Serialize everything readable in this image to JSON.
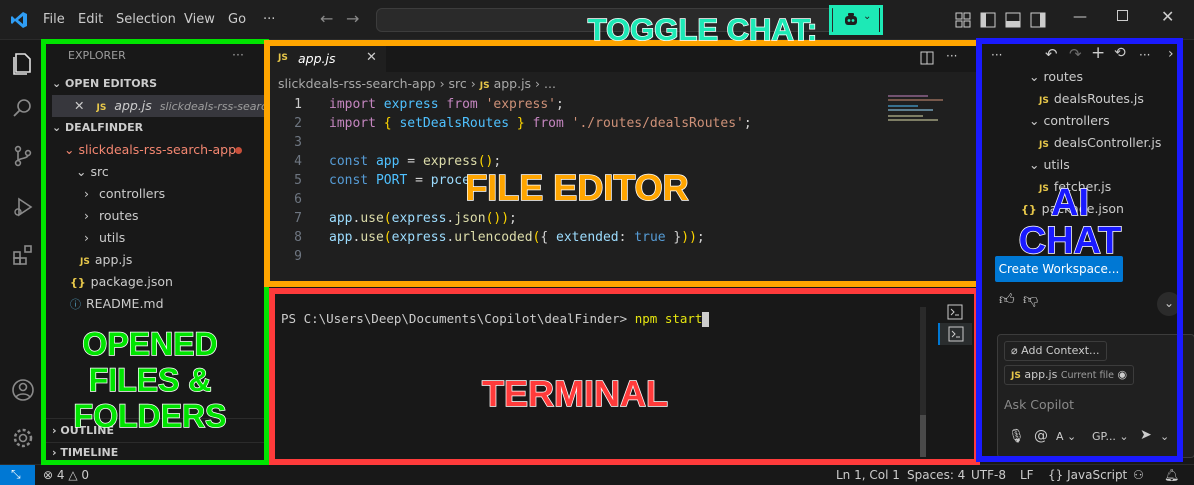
{
  "menu": {
    "file": "File",
    "edit": "Edit",
    "selection": "Selection",
    "view": "View",
    "go": "Go",
    "more": "···"
  },
  "explorer": {
    "title": "EXPLORER",
    "open_editors": "OPEN EDITORS",
    "open_file": "app.js",
    "open_file_path": "slickdeals-rss-searc...",
    "folder": "DEALFINDER",
    "root": "slickdeals-rss-search-app",
    "tree": [
      "src",
      "controllers",
      "routes",
      "utils",
      "app.js",
      "package.json",
      "README.md"
    ],
    "outline": "OUTLINE",
    "timeline": "TIMELINE"
  },
  "editor": {
    "tab": "app.js",
    "breadcrumb": [
      "slickdeals-rss-search-app",
      "src",
      "app.js",
      "..."
    ],
    "line_numbers": [
      "1",
      "2",
      "3",
      "4",
      "5",
      "6",
      "7",
      "8",
      "9"
    ]
  },
  "terminal": {
    "prompt": "PS C:\\Users\\Deep\\Documents\\Copilot\\dealFinder>",
    "command": "npm start"
  },
  "chat": {
    "tree": [
      "routes",
      "dealsRoutes.js",
      "controllers",
      "dealsController.js",
      "utils",
      "fetcher.js",
      "package.json"
    ],
    "create_workspace": "Create Workspace...",
    "add_context": "Add Context...",
    "current_file": "app.js",
    "current_file_note": "Current file",
    "ask_placeholder": "Ask Copilot",
    "mode": "A",
    "model": "GP..."
  },
  "status": {
    "problems": "4",
    "warnings": "0",
    "position": "Ln 1, Col 1",
    "spaces": "Spaces: 4",
    "encoding": "UTF-8",
    "eol": "LF",
    "language": "JavaScript"
  },
  "overlays": {
    "toggle_chat": "TOGGLE CHAT:",
    "file_editor": "FILE EDITOR",
    "ai_chat_1": "AI",
    "ai_chat_2": "CHAT",
    "opened_1": "OPENED",
    "opened_2": "FILES &",
    "opened_3": "FOLDERS",
    "terminal": "TERMINAL"
  },
  "colors": {
    "green": "#00e400",
    "orange": "#ffa500",
    "blue": "#1a1aff",
    "red": "#ff3b3b",
    "cyan": "#1de9b6",
    "accent": "#0078d4"
  }
}
